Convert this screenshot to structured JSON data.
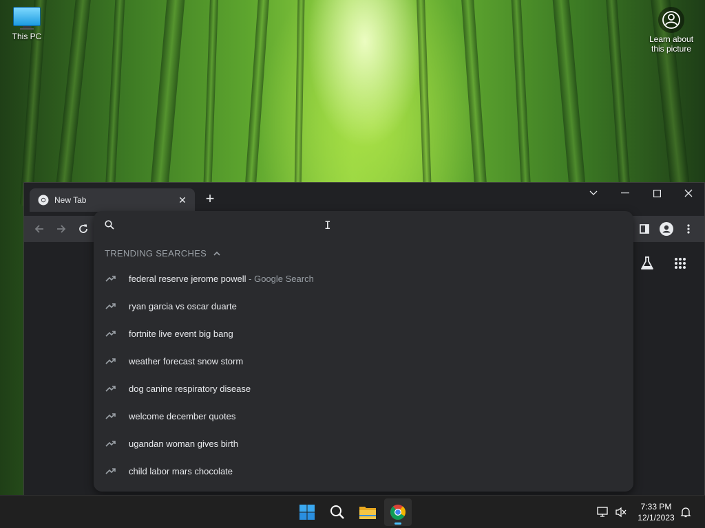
{
  "desktop": {
    "icons": [
      {
        "label": "This PC",
        "icon": "monitor-icon"
      }
    ],
    "spotlight": {
      "label": "Learn about this picture",
      "icon": "camera-info-icon"
    }
  },
  "browser": {
    "tab": {
      "title": "New Tab",
      "icon": "chrome-icon",
      "close_icon": "close-icon"
    },
    "new_tab_icon": "plus-icon",
    "window_controls": [
      "tab-search-icon",
      "minimize-icon",
      "maximize-icon",
      "close-icon"
    ],
    "toolbar": {
      "back_icon": "arrow-left-icon",
      "forward_icon": "arrow-right-icon",
      "reload_icon": "reload-icon",
      "side_panel_icon": "side-panel-icon",
      "profile_icon": "profile-icon",
      "menu_icon": "kebab-menu-icon"
    },
    "page_icons": [
      "labs-flask-icon",
      "apps-grid-icon"
    ]
  },
  "omnibox": {
    "value": "",
    "placeholder": "",
    "section_header": "TRENDING SEARCHES",
    "suggestions": [
      {
        "text": "federal reserve jerome powell",
        "hint": "Google Search"
      },
      {
        "text": "ryan garcia vs oscar duarte"
      },
      {
        "text": "fortnite live event big bang"
      },
      {
        "text": "weather forecast snow storm"
      },
      {
        "text": "dog canine respiratory disease"
      },
      {
        "text": "welcome december quotes"
      },
      {
        "text": "ugandan woman gives birth"
      },
      {
        "text": "child labor mars chocolate"
      }
    ]
  },
  "taskbar": {
    "apps": [
      "windows-start-icon",
      "search-icon",
      "file-explorer-icon",
      "chrome-icon"
    ],
    "active_app": "chrome-icon",
    "tray": [
      "network-icon",
      "volume-muted-icon"
    ],
    "time": "7:33 PM",
    "date": "12/1/2023",
    "notifications_icon": "bell-icon"
  },
  "colors": {
    "browser_bg": "#202124",
    "toolbar_bg": "#35363a",
    "dropdown_bg": "#2a2b2e",
    "text_primary": "#e8eaed",
    "text_secondary": "#9aa0a6",
    "taskbar_bg": "#202020",
    "accent": "#4cc2ff"
  }
}
